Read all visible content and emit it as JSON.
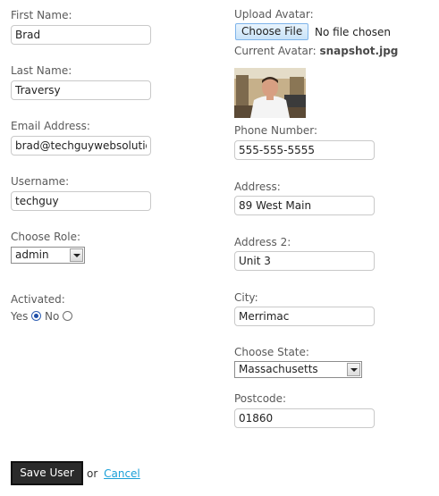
{
  "form": {
    "first_name": {
      "label": "First Name:",
      "value": "Brad"
    },
    "last_name": {
      "label": "Last Name:",
      "value": "Traversy"
    },
    "email": {
      "label": "Email Address:",
      "value": "brad@techguywebsolutions.com"
    },
    "username": {
      "label": "Username:",
      "value": "techguy"
    },
    "role": {
      "label": "Choose Role:",
      "selected": "admin"
    },
    "activated": {
      "label": "Activated:",
      "yes_label": "Yes",
      "no_label": "No",
      "selected": "Yes"
    },
    "avatar": {
      "label": "Upload Avatar:",
      "button_label": "Choose File",
      "file_status": "No file chosen",
      "current_label": "Current Avatar:",
      "current_file": "snapshot.jpg"
    },
    "phone": {
      "label": "Phone Number:",
      "value": "555-555-5555"
    },
    "address": {
      "label": "Address:",
      "value": "89 West Main"
    },
    "address2": {
      "label": "Address 2:",
      "value": "Unit 3"
    },
    "city": {
      "label": "City:",
      "value": "Merrimac"
    },
    "state": {
      "label": "Choose State:",
      "selected": "Massachusetts"
    },
    "postcode": {
      "label": "Postcode:",
      "value": "01860"
    }
  },
  "actions": {
    "save_label": "Save User",
    "or_text": "or",
    "cancel_label": "Cancel"
  },
  "colors": {
    "link": "#1aa0d8",
    "save_button_bg": "#2b2b2b",
    "file_button_bg": "#c8e2f8"
  }
}
